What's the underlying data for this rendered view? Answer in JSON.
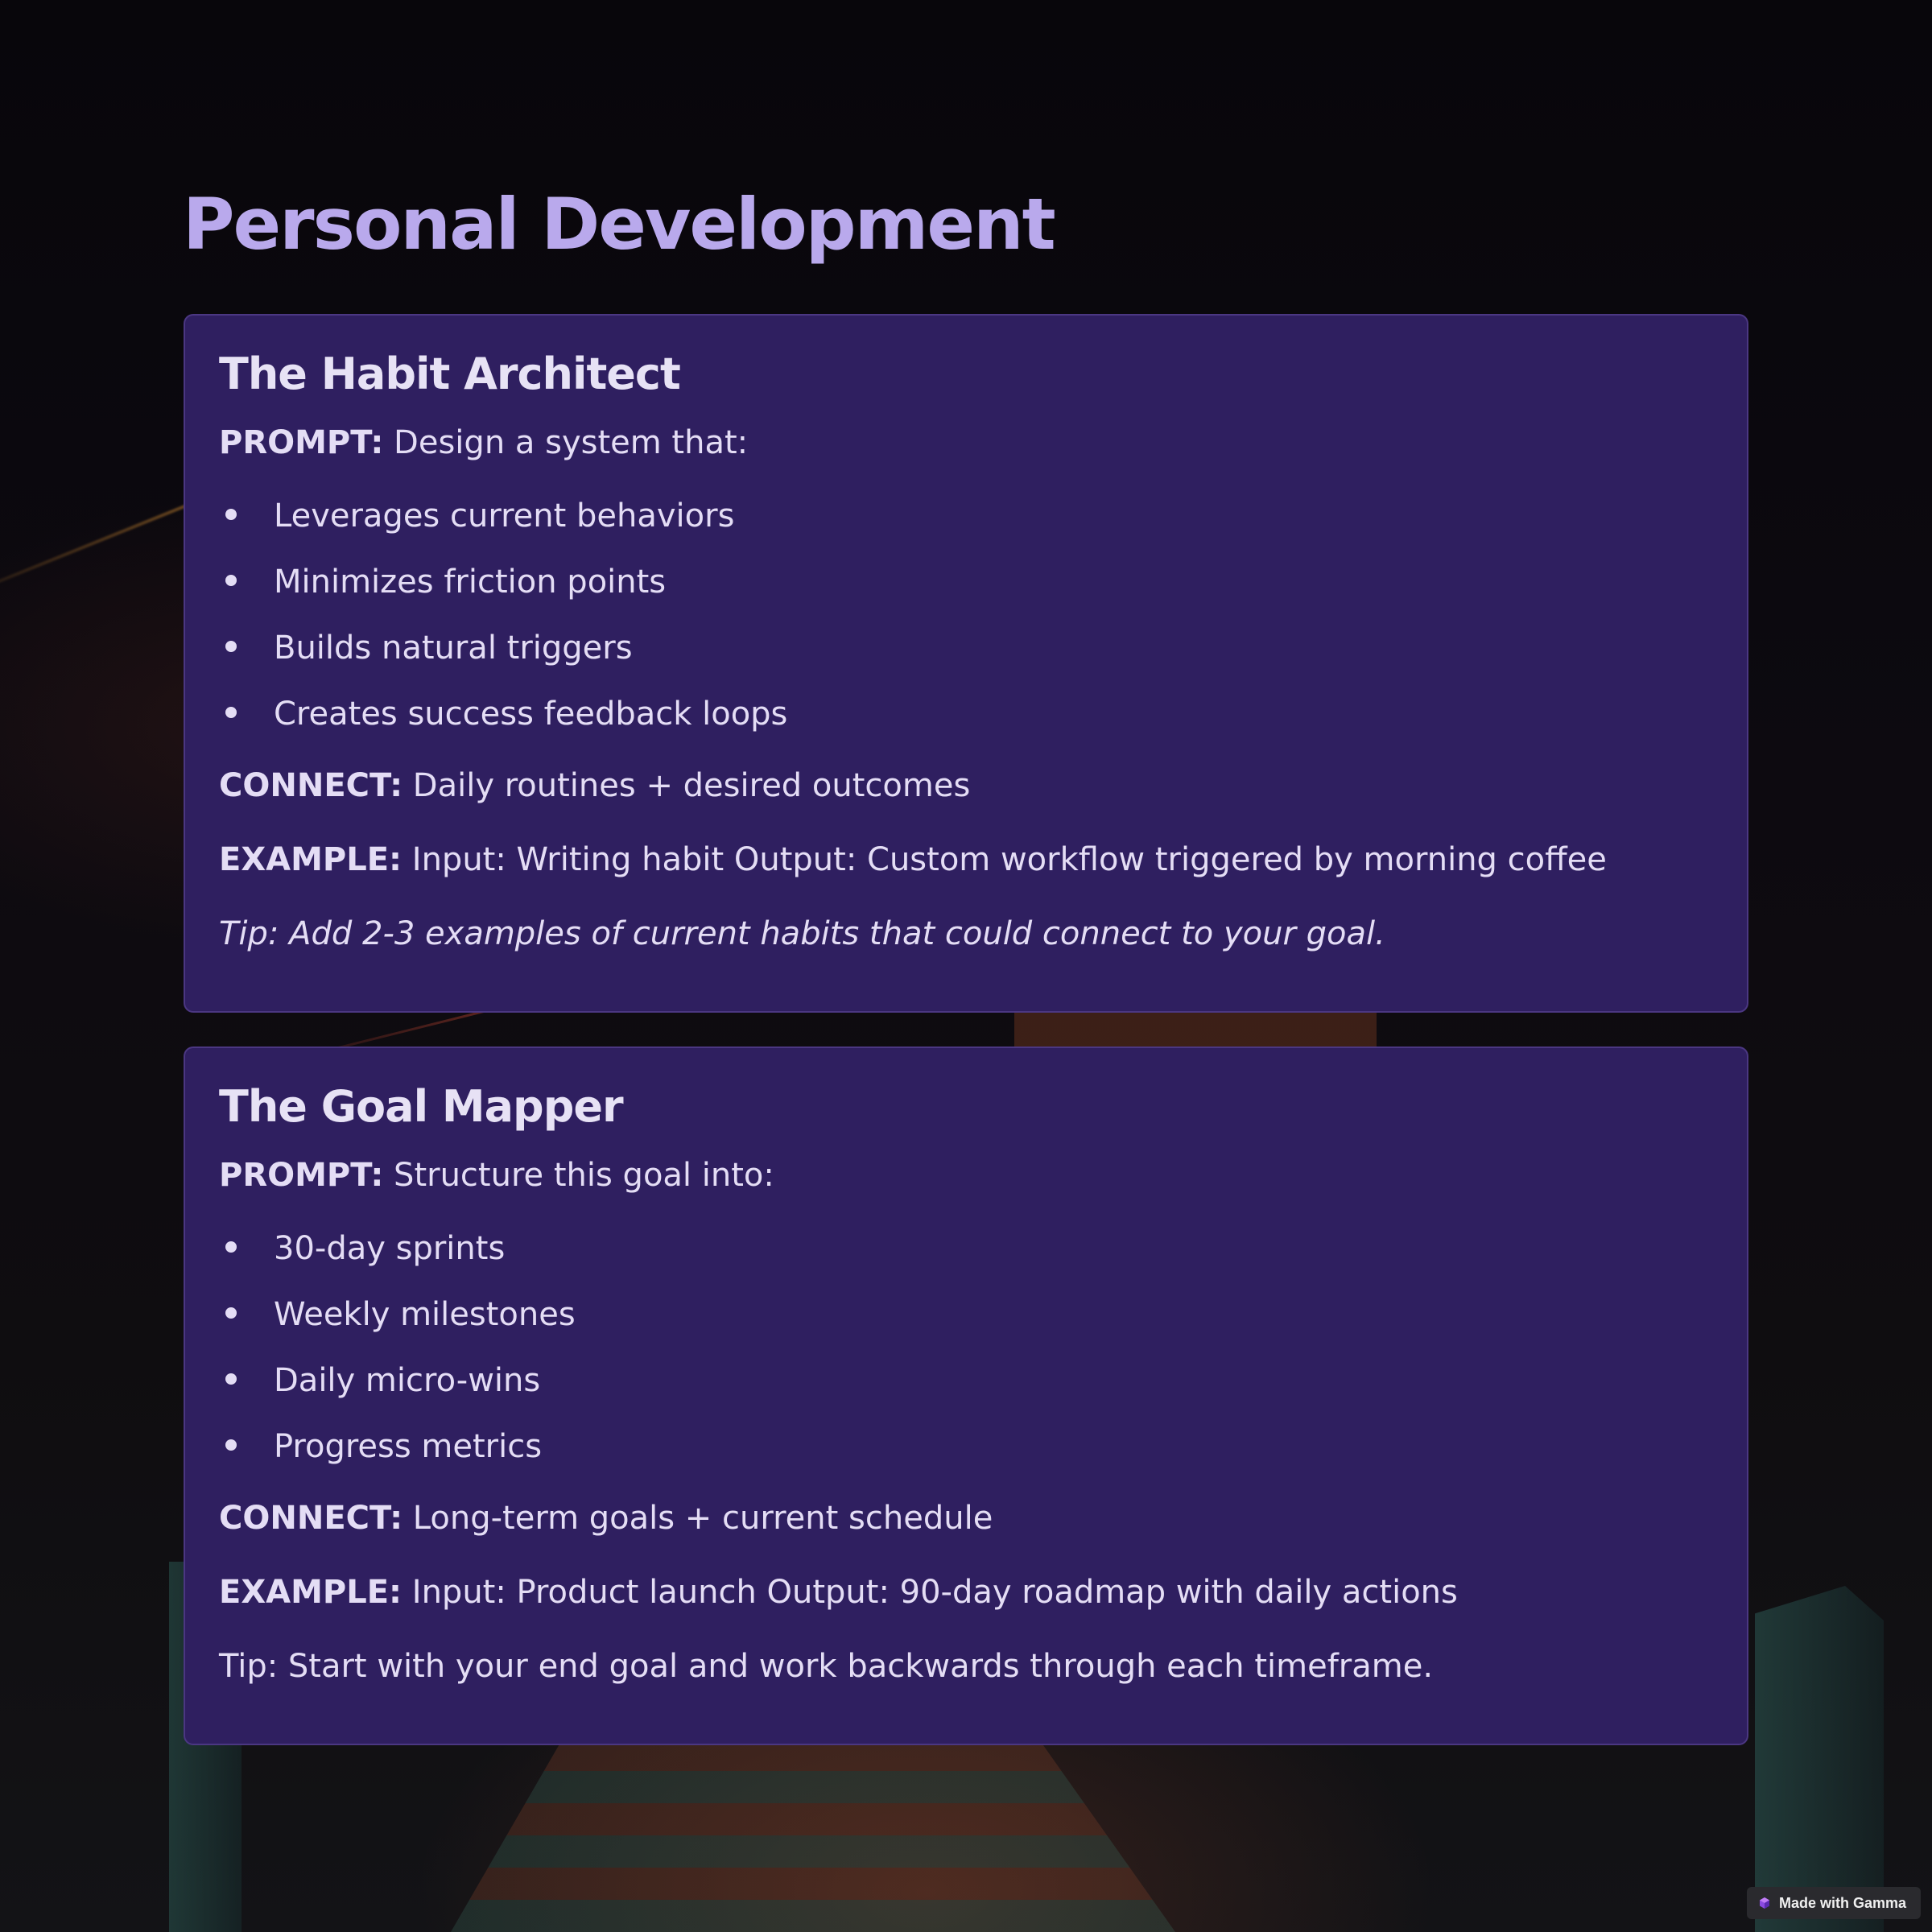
{
  "page": {
    "title": "Personal Development"
  },
  "cards": [
    {
      "title": "The Habit Architect",
      "prompt_label": "PROMPT:",
      "prompt_text": " Design a system that:",
      "bullets": [
        "Leverages current behaviors",
        "Minimizes friction points",
        "Builds natural triggers",
        "Creates success feedback loops"
      ],
      "connect_label": "CONNECT:",
      "connect_text": " Daily routines + desired outcomes",
      "example_label": "EXAMPLE:",
      "example_text": " Input: Writing habit Output: Custom workflow triggered by morning coffee",
      "tip": "Tip: Add 2-3 examples of current habits that could connect to your goal."
    },
    {
      "title": "The Goal Mapper",
      "prompt_label": "PROMPT:",
      "prompt_text": " Structure this goal into:",
      "bullets": [
        "30-day sprints",
        "Weekly milestones",
        "Daily micro-wins",
        "Progress metrics"
      ],
      "connect_label": "CONNECT:",
      "connect_text": " Long-term goals + current schedule",
      "example_label": "EXAMPLE:",
      "example_text": " Input: Product launch Output: 90-day roadmap with daily actions",
      "tip": "Tip: Start with your end goal and work backwards through each timeframe."
    }
  ],
  "badge": {
    "label": "Made with Gamma",
    "icon": "gamma-logo-icon"
  },
  "colors": {
    "title": "#b9a9ec",
    "card_bg": "#2f1f60",
    "text": "#e4ddf5",
    "background": "#0a070d"
  }
}
